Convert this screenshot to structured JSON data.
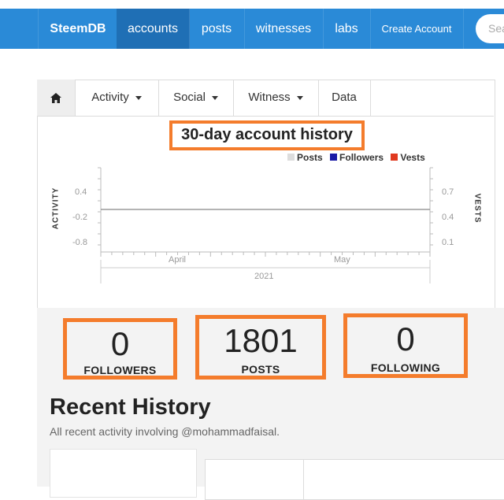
{
  "nav": {
    "brand": "SteemDB",
    "items": [
      "accounts",
      "posts",
      "witnesses",
      "labs",
      "Create Account"
    ],
    "search_placeholder": "Sea"
  },
  "tabs": {
    "home_icon": "home-icon",
    "items": [
      "Activity",
      "Social",
      "Witness",
      "Data"
    ]
  },
  "chart_data": {
    "type": "line",
    "title": "30-day account history",
    "legend": [
      {
        "name": "Posts",
        "color": "#dddddd"
      },
      {
        "name": "Followers",
        "color": "#1a1aa6"
      },
      {
        "name": "Vests",
        "color": "#e0391f"
      }
    ],
    "y_left_label": "ACTIVITY",
    "y_left_ticks": [
      "0.4",
      "-0.2",
      "-0.8"
    ],
    "y_right_label": "VESTS",
    "y_right_ticks": [
      "0.7",
      "0.4",
      "0.1"
    ],
    "x_ticks": [
      "April",
      "May"
    ],
    "x_year": "2021",
    "series": [
      {
        "name": "Posts",
        "values": [
          0
        ]
      }
    ]
  },
  "stats": [
    {
      "value": "0",
      "label": "FOLLOWERS"
    },
    {
      "value": "1801",
      "label": "POSTS"
    },
    {
      "value": "0",
      "label": "FOLLOWING"
    }
  ],
  "recent": {
    "title": "Recent History",
    "subtitle": "All recent activity involving @mohammadfaisal."
  },
  "colors": {
    "nav": "#2a8ad7",
    "nav_active": "#1f6fb5",
    "highlight": "#f47c2c"
  }
}
